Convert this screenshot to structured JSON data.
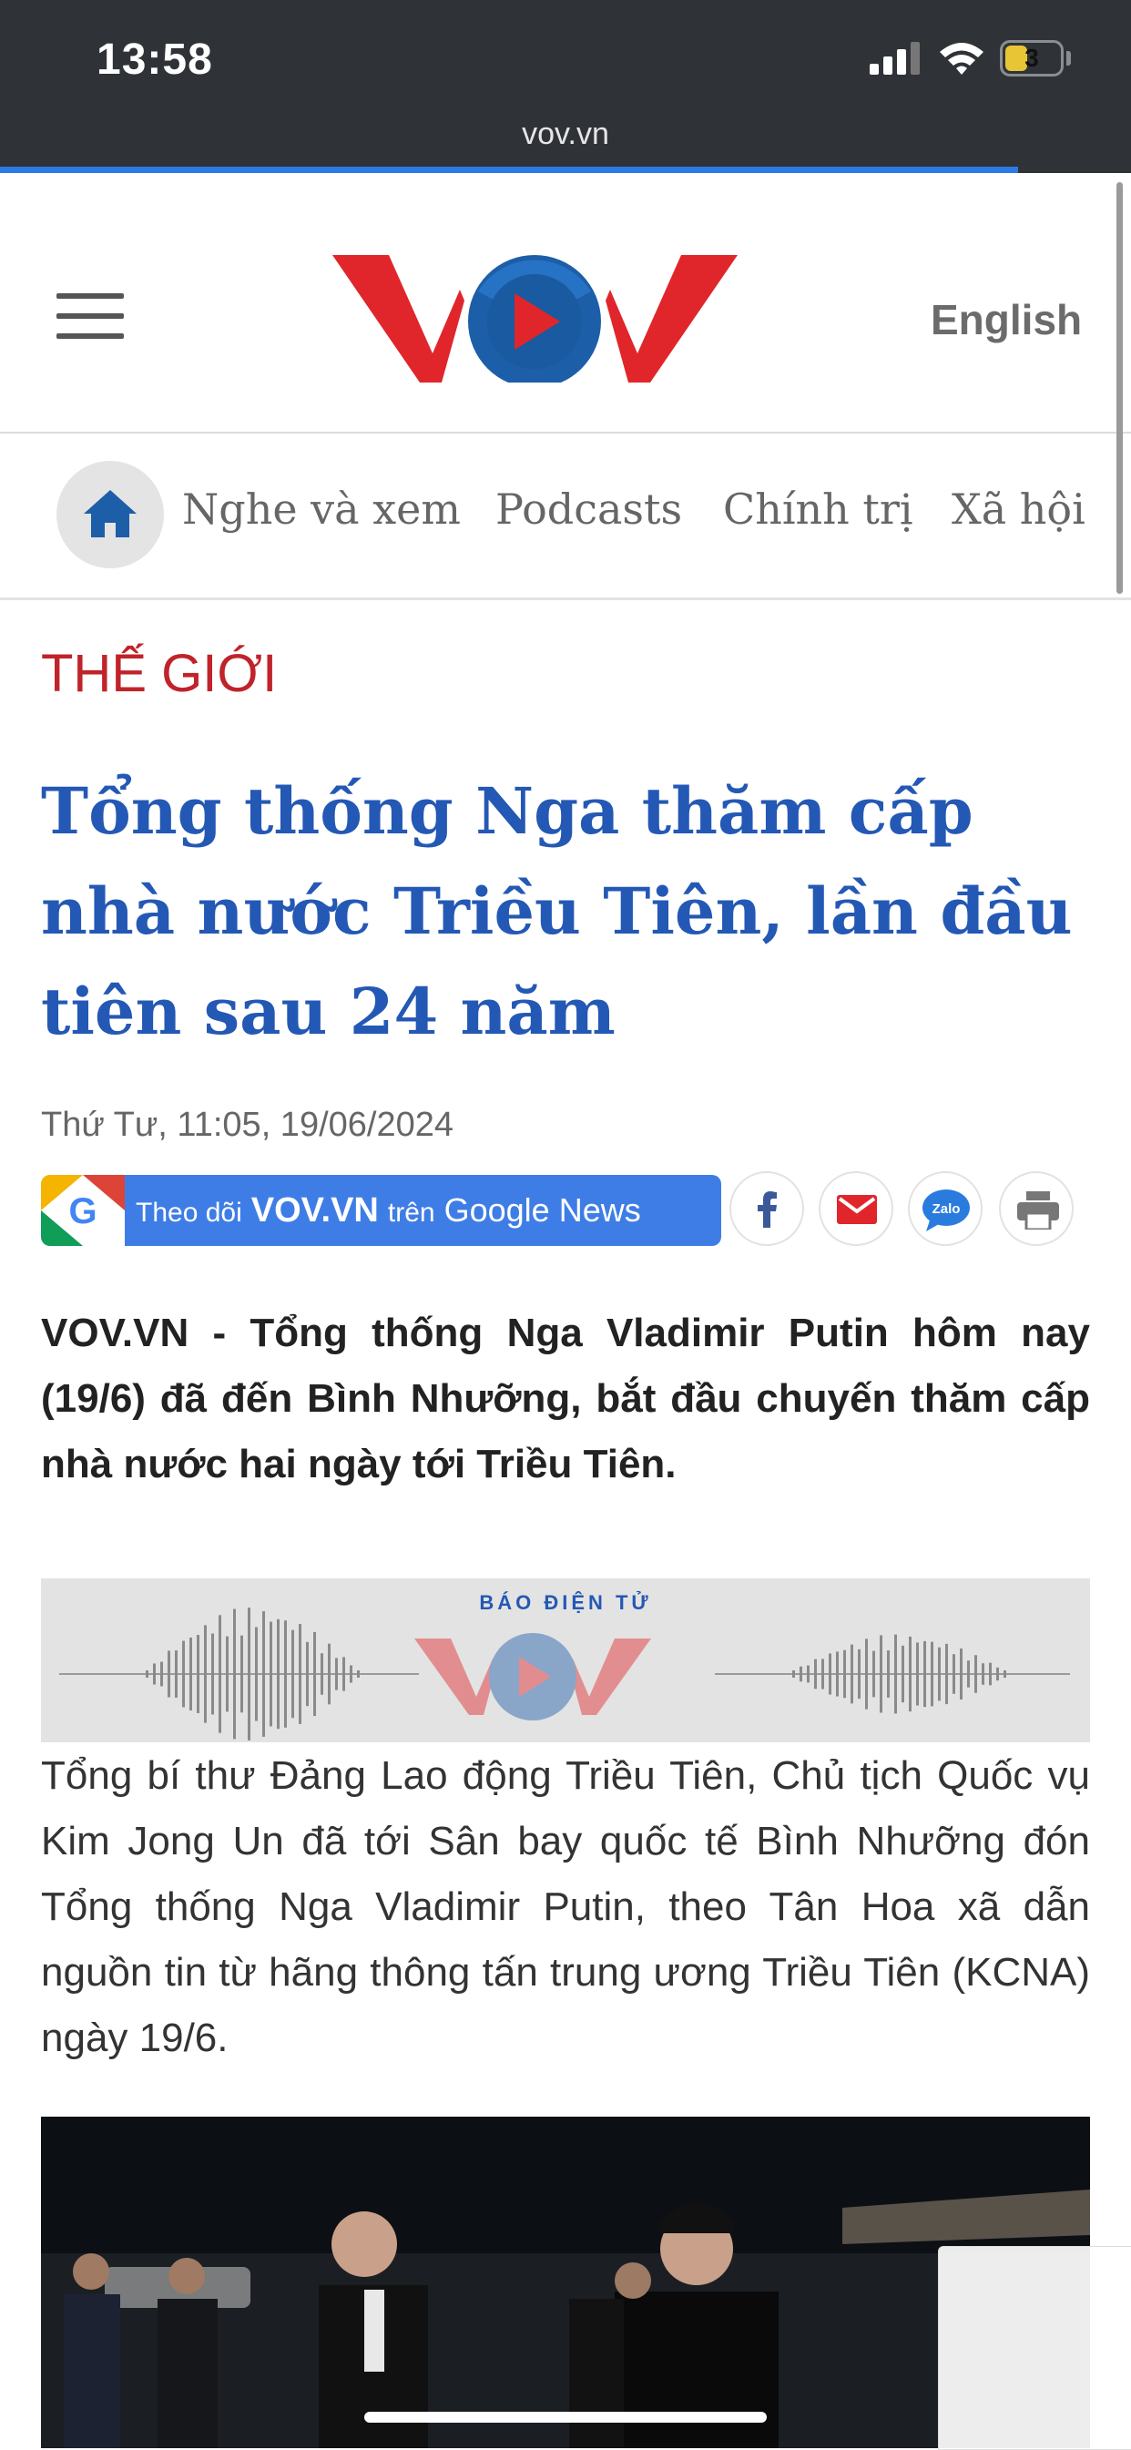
{
  "status_bar": {
    "time": "13:58",
    "battery": "3",
    "url": "vov.vn",
    "page_load_progress": 0.9
  },
  "header": {
    "language_link": "English",
    "logo_text": "VOV"
  },
  "nav": {
    "items": [
      "Nghe và xem",
      "Podcasts",
      "Chính trị",
      "Xã hội"
    ]
  },
  "article": {
    "category": "THẾ GIỚI",
    "title": "Tổng thống Nga thăm cấp nhà nước Triều Tiên, lần đầu tiên sau 24 năm",
    "date": "Thứ Tư, 11:05, 19/06/2024",
    "google_news": {
      "prefix": "Theo dõi",
      "brand": "VOV.VN",
      "middle": "trên",
      "service": "Google News"
    },
    "lead": "VOV.VN - Tổng thống Nga Vladimir Putin hôm nay (19/6) đã đến Bình Nhưỡng, bắt đầu chuyến thăm cấp nhà nước hai ngày tới Triều Tiên.",
    "audio_banner_label": "BÁO ĐIỆN TỬ",
    "body": "Tổng bí thư Đảng Lao động Triều Tiên, Chủ tịch Quốc vụ Kim Jong Un đã tới Sân bay quốc tế Bình Nhưỡng đón Tổng thống Nga Vladimir Putin, theo Tân Hoa xã dẫn nguồn tin từ hãng thông tấn trung ương Triều Tiên (KCNA) ngày 19/6."
  },
  "colors": {
    "brand_red": "#e0262b",
    "brand_blue": "#2458b5",
    "category_red": "#c0232a",
    "google_news_blue": "#3f7de6"
  },
  "icons": [
    "home-icon",
    "facebook-icon",
    "mail-icon",
    "zalo-icon",
    "print-icon",
    "menu-icon"
  ]
}
